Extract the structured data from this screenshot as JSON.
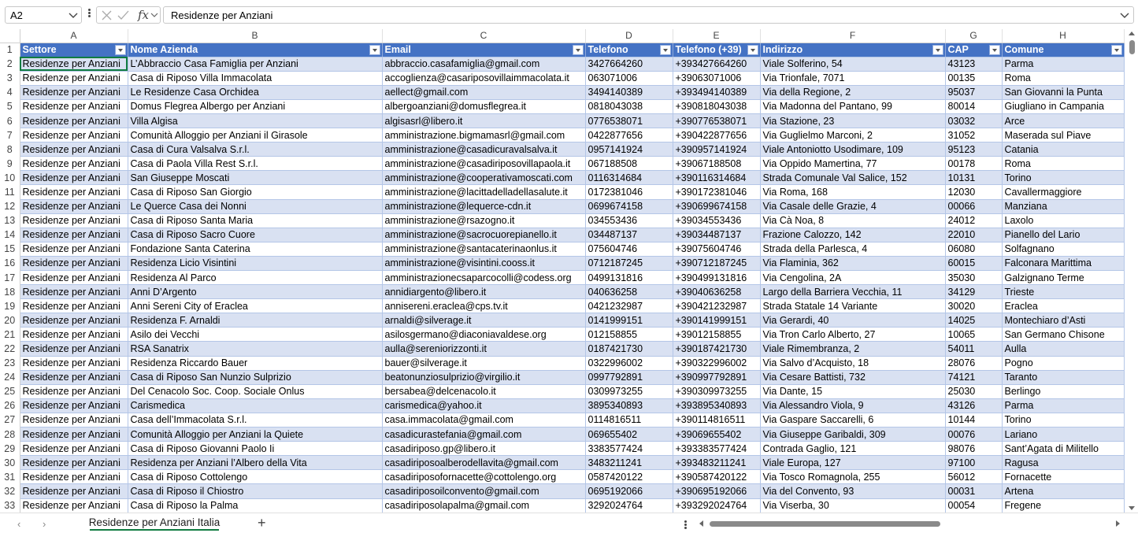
{
  "formula_bar": {
    "name_box": "A2",
    "content": "Residenze per Anziani",
    "fx_label": "fx"
  },
  "sheet": {
    "column_letters": [
      "A",
      "B",
      "C",
      "D",
      "E",
      "F",
      "G",
      "H"
    ],
    "headers": [
      "Settore",
      "Nome Azienda",
      "Email",
      "Telefono",
      "Telefono (+39)",
      "Indirizzo",
      "CAP",
      "Comune"
    ],
    "rows": [
      [
        "2",
        "Residenze per Anziani",
        "L’Abbraccio Casa Famiglia per Anziani",
        "abbraccio.casafamiglia@gmail.com",
        "3427664260",
        "+393427664260",
        "Viale Solferino, 54",
        "43123",
        "Parma"
      ],
      [
        "3",
        "Residenze per Anziani",
        "Casa di Riposo Villa Immacolata",
        "accoglienza@casariposovillaimmacolata.it",
        "063071006",
        "+39063071006",
        "Via Trionfale, 7071",
        "00135",
        "Roma"
      ],
      [
        "4",
        "Residenze per Anziani",
        "Le Residenze Casa Orchidea",
        "aellect@gmail.com",
        "3494140389",
        "+393494140389",
        "Via della Regione, 2",
        "95037",
        "San Giovanni la Punta"
      ],
      [
        "5",
        "Residenze per Anziani",
        "Domus Flegrea Albergo per Anziani",
        "albergoanziani@domusflegrea.it",
        "0818043038",
        "+390818043038",
        "Via Madonna del Pantano, 99",
        "80014",
        "Giugliano in Campania"
      ],
      [
        "6",
        "Residenze per Anziani",
        "Villa Algisa",
        "algisasrl@libero.it",
        "0776538071",
        "+390776538071",
        "Via Stazione, 23",
        "03032",
        "Arce"
      ],
      [
        "7",
        "Residenze per Anziani",
        "Comunità Alloggio per Anziani il Girasole",
        "amministrazione.bigmamasrl@gmail.com",
        "0422877656",
        "+390422877656",
        "Via Guglielmo Marconi, 2",
        "31052",
        "Maserada sul Piave"
      ],
      [
        "8",
        "Residenze per Anziani",
        "Casa di Cura Valsalva S.r.l.",
        "amministrazione@casadicuravalsalva.it",
        "0957141924",
        "+390957141924",
        "Viale Antoniotto Usodimare, 109",
        "95123",
        "Catania"
      ],
      [
        "9",
        "Residenze per Anziani",
        "Casa di Paola Villa Rest S.r.l.",
        "amministrazione@casadiriposovillapaola.it",
        "067188508",
        "+39067188508",
        "Via Oppido Mamertina, 77",
        "00178",
        "Roma"
      ],
      [
        "10",
        "Residenze per Anziani",
        "San Giuseppe Moscati",
        "amministrazione@cooperativamoscati.com",
        "0116314684",
        "+390116314684",
        "Strada Comunale Val Salice, 152",
        "10131",
        "Torino"
      ],
      [
        "11",
        "Residenze per Anziani",
        "Casa di Riposo San Giorgio",
        "amministrazione@lacittadelladellasalute.it",
        "0172381046",
        "+390172381046",
        "Via Roma, 168",
        "12030",
        "Cavallermaggiore"
      ],
      [
        "12",
        "Residenze per Anziani",
        "Le Querce Casa dei Nonni",
        "amministrazione@lequerce-cdn.it",
        "0699674158",
        "+390699674158",
        "Via Casale delle Grazie, 4",
        "00066",
        "Manziana"
      ],
      [
        "13",
        "Residenze per Anziani",
        "Casa di Riposo Santa Maria",
        "amministrazione@rsazogno.it",
        "034553436",
        "+39034553436",
        "Via Cà Noa, 8",
        "24012",
        "Laxolo"
      ],
      [
        "14",
        "Residenze per Anziani",
        "Casa di Riposo Sacro Cuore",
        "amministrazione@sacrocuorepianello.it",
        "034487137",
        "+39034487137",
        "Frazione Calozzo, 142",
        "22010",
        "Pianello del Lario"
      ],
      [
        "15",
        "Residenze per Anziani",
        "Fondazione Santa Caterina",
        "amministrazione@santacaterinaonlus.it",
        "075604746",
        "+39075604746",
        "Strada della Parlesca, 4",
        "06080",
        "Solfagnano"
      ],
      [
        "16",
        "Residenze per Anziani",
        "Residenza Licio Visintini",
        "amministrazione@visintini.cooss.it",
        "0712187245",
        "+390712187245",
        "Via Flaminia, 362",
        "60015",
        "Falconara Marittima"
      ],
      [
        "17",
        "Residenze per Anziani",
        "Residenza Al Parco",
        "amministrazionecsaparcocolli@codess.org",
        "0499131816",
        "+390499131816",
        "Via Cengolina, 2A",
        "35030",
        "Galzignano Terme"
      ],
      [
        "18",
        "Residenze per Anziani",
        "Anni D’Argento",
        "annidiargento@libero.it",
        "040636258",
        "+39040636258",
        "Largo della Barriera Vecchia, 11",
        "34129",
        "Trieste"
      ],
      [
        "19",
        "Residenze per Anziani",
        "Anni Sereni City of Eraclea",
        "annisereni.eraclea@cps.tv.it",
        "0421232987",
        "+390421232987",
        "Strada Statale 14 Variante",
        "30020",
        "Eraclea"
      ],
      [
        "20",
        "Residenze per Anziani",
        "Residenza F. Arnaldi",
        "arnaldi@silverage.it",
        "0141999151",
        "+390141999151",
        "Via Gerardi, 40",
        "14025",
        "Montechiaro d’Asti"
      ],
      [
        "21",
        "Residenze per Anziani",
        "Asilo dei Vecchi",
        "asilosgermano@diaconiavaldese.org",
        "012158855",
        "+39012158855",
        "Via Tron Carlo Alberto, 27",
        "10065",
        "San Germano Chisone"
      ],
      [
        "22",
        "Residenze per Anziani",
        "RSA Sanatrix",
        "aulla@sereniorizzonti.it",
        "0187421730",
        "+390187421730",
        "Viale Rimembranza, 2",
        "54011",
        "Aulla"
      ],
      [
        "23",
        "Residenze per Anziani",
        "Residenza Riccardo Bauer",
        "bauer@silverage.it",
        "0322996002",
        "+390322996002",
        "Via Salvo d’Acquisto, 18",
        "28076",
        "Pogno"
      ],
      [
        "24",
        "Residenze per Anziani",
        "Casa di Riposo San Nunzio Sulprizio",
        "beatonunziosulprizio@virgilio.it",
        "0997792891",
        "+390997792891",
        "Via Cesare Battisti, 732",
        "74121",
        "Taranto"
      ],
      [
        "25",
        "Residenze per Anziani",
        "Del Cenacolo Soc. Coop. Sociale Onlus",
        "bersabea@delcenacolo.it",
        "0309973255",
        "+390309973255",
        "Via Dante, 15",
        "25030",
        "Berlingo"
      ],
      [
        "26",
        "Residenze per Anziani",
        "Carismedica",
        "carismedica@yahoo.it",
        "3895340893",
        "+393895340893",
        "Via Alessandro Viola, 9",
        "43126",
        "Parma"
      ],
      [
        "27",
        "Residenze per Anziani",
        "Casa dell’Immacolata S.r.l.",
        "casa.immacolata@gmail.com",
        "0114816511",
        "+390114816511",
        "Via Gaspare Saccarelli, 6",
        "10144",
        "Torino"
      ],
      [
        "28",
        "Residenze per Anziani",
        "Comunità Alloggio per Anziani la Quiete",
        "casadicurastefania@gmail.com",
        "069655402",
        "+39069655402",
        "Via Giuseppe Garibaldi, 309",
        "00076",
        "Lariano"
      ],
      [
        "29",
        "Residenze per Anziani",
        "Casa di Riposo Giovanni Paolo Ii",
        "casadiriposo.gp@libero.it",
        "3383577424",
        "+393383577424",
        "Contrada Gaglio, 121",
        "98076",
        "Sant’Agata di Militello"
      ],
      [
        "30",
        "Residenze per Anziani",
        "Residenza per Anziani l’Albero della Vita",
        "casadiriposoalberodellavita@gmail.com",
        "3483211241",
        "+393483211241",
        "Viale Europa, 127",
        "97100",
        "Ragusa"
      ],
      [
        "31",
        "Residenze per Anziani",
        "Casa di Riposo Cottolengo",
        "casadiriposofornacette@cottolengo.org",
        "0587420122",
        "+390587420122",
        "Via Tosco Romagnola, 255",
        "56012",
        "Fornacette"
      ],
      [
        "32",
        "Residenze per Anziani",
        "Casa di Riposo il Chiostro",
        "casadiriposoilconvento@gmail.com",
        "0695192066",
        "+390695192066",
        "Via del Convento, 93",
        "00031",
        "Artena"
      ],
      [
        "33",
        "Residenze per Anziani",
        "Casa di Riposo la Palma",
        "casadiriposolapalma@gmail.com",
        "3292024764",
        "+393292024764",
        "Via Viserba, 30",
        "00054",
        "Fregene"
      ]
    ]
  },
  "sheet_tabs": [
    {
      "label": "Residenze per Anziani Italia",
      "active": true
    }
  ],
  "colors": {
    "header_fill": "#4472c4",
    "band_fill": "#d9e1f2",
    "accent_green": "#107c41"
  }
}
